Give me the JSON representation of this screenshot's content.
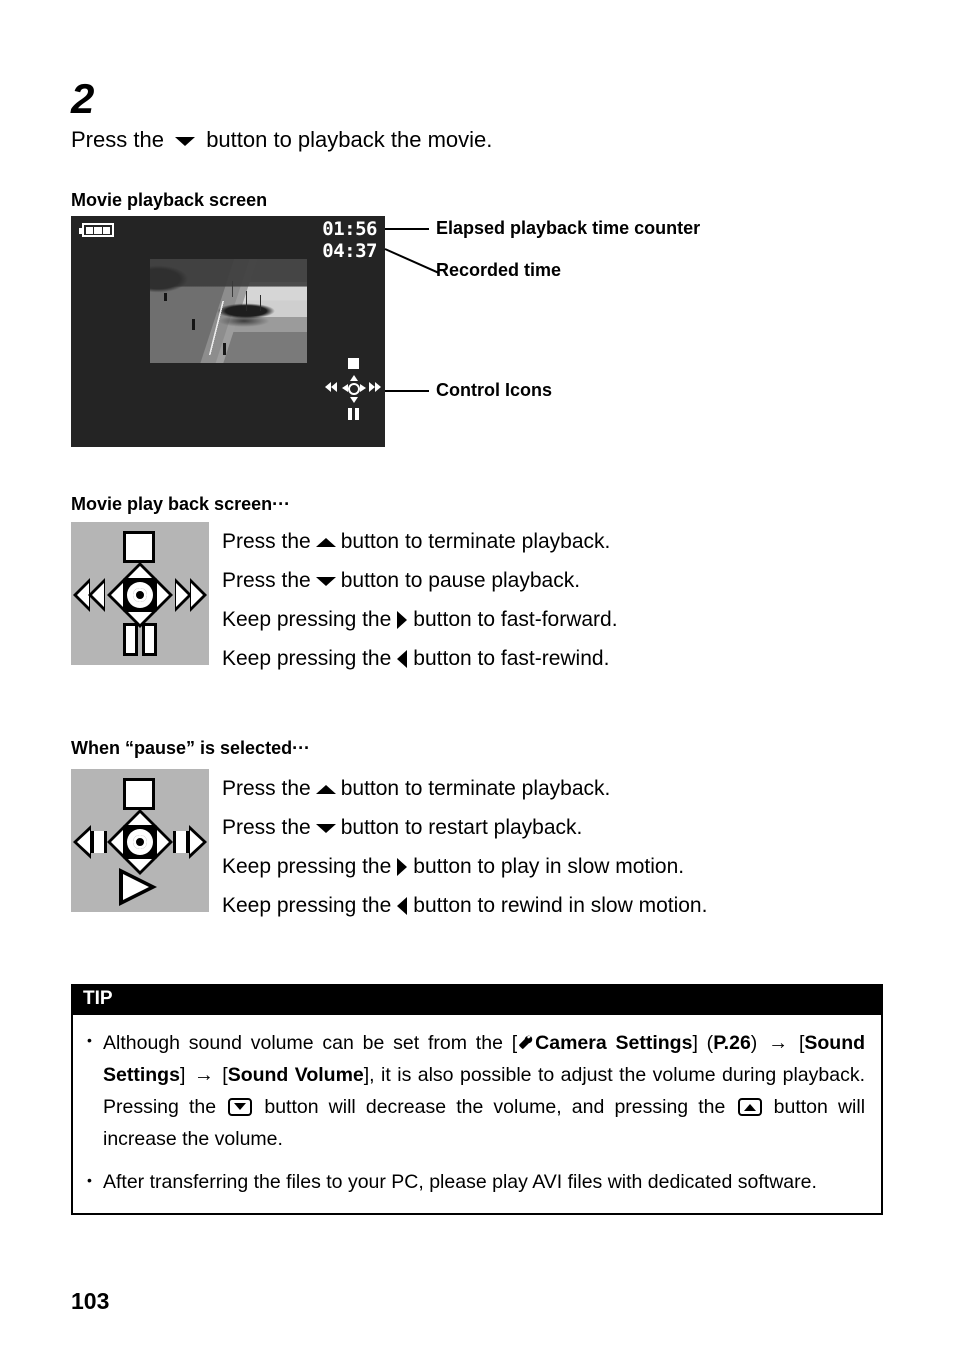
{
  "step": {
    "number": "2",
    "text_before": "Press the",
    "arrow_icon": "down-triangle",
    "text_after": "button to playback the movie."
  },
  "sections": {
    "playback_screen_heading": "Movie playback screen",
    "play_back_screen_heading": "Movie play back screen···",
    "pause_selected_heading": "When “pause” is selected···"
  },
  "lcd": {
    "battery_icon": "battery-full-icon",
    "elapsed_time": "01:56",
    "recorded_time": "04:37",
    "photo_alt": "harbor-scene-thumbnail",
    "control_icons": {
      "stop": "stop-square-icon",
      "pause": "pause-bars-icon",
      "fast_rewind": "double-left-arrow-icon",
      "fast_forward": "double-right-arrow-icon",
      "center": "center-circle-icon"
    },
    "background_color": "#242424"
  },
  "callouts": [
    {
      "label": "Elapsed playback time counter"
    },
    {
      "label": "Recorded time"
    },
    {
      "label": "Control Icons"
    }
  ],
  "playback_instructions": [
    {
      "pre": "Press the",
      "glyph": "up-triangle",
      "post": "button to terminate playback."
    },
    {
      "pre": "Press the",
      "glyph": "down-triangle",
      "post": "button to pause playback."
    },
    {
      "pre": "Keep pressing the",
      "glyph": "right-triangle",
      "post": "button to fast-forward."
    },
    {
      "pre": "Keep pressing the",
      "glyph": "left-triangle",
      "post": "button to fast-rewind."
    }
  ],
  "pause_instructions": [
    {
      "pre": "Press the",
      "glyph": "up-triangle",
      "post": "button to terminate playback."
    },
    {
      "pre": "Press the",
      "glyph": "down-triangle",
      "post": "button to restart playback."
    },
    {
      "pre": "Keep pressing the",
      "glyph": "right-triangle",
      "post": "button to play in slow motion."
    },
    {
      "pre": "Keep pressing the",
      "glyph": "left-triangle",
      "post": "button to rewind in slow motion."
    }
  ],
  "diagram_playback": {
    "top_icon": "stop-square-icon",
    "bottom_icon": "pause-bars-icon",
    "left_icon": "double-left-chevron-icon",
    "right_icon": "double-right-chevron-icon",
    "background_color": "#b5b5b5"
  },
  "diagram_pause": {
    "top_icon": "stop-square-icon",
    "bottom_icon": "play-triangle-icon",
    "left_icon": "slow-rewind-icon",
    "right_icon": "slow-forward-icon",
    "background_color": "#b5b5b5"
  },
  "tip": {
    "header": "TIP",
    "bullet": "•",
    "items": [
      {
        "p1": "Although sound volume can be set from the [",
        "wrench_icon": "wrench-icon",
        "menu1": "Camera Settings",
        "p2": "] (",
        "page_ref": "P.26",
        "p3": ")",
        "arrow1": "→",
        "p4": "[",
        "menu2": "Sound Settings",
        "p5": "]",
        "arrow2": "→",
        "p6": "[",
        "menu3": "Sound Volume",
        "p7": "], it is also possible to adjust the volume during playback. Pressing the",
        "key_down_icon": "volume-down-key-icon",
        "p8": "button will decrease the volume, and pressing the",
        "key_up_icon": "volume-up-key-icon",
        "p9": "button will increase the volume."
      },
      {
        "text": "After transferring the files to your PC, please play AVI files with dedicated software."
      }
    ]
  },
  "page_number": "103"
}
